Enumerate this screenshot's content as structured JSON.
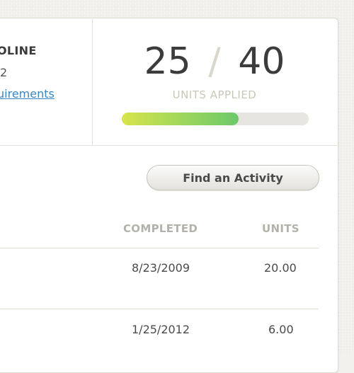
{
  "status": {
    "title": "OLINE",
    "subtitle": "2",
    "link_text": "uirements"
  },
  "units": {
    "applied": "25",
    "separator": "/",
    "required": "40",
    "label": "UNITS APPLIED",
    "progress_fraction": 0.625
  },
  "actions": {
    "find_activity_label": "Find an Activity"
  },
  "table": {
    "headers": {
      "completed": "COMPLETED",
      "units": "UNITS"
    },
    "rows": [
      {
        "completed": "8/23/2009",
        "units": "20.00"
      },
      {
        "completed": "1/25/2012",
        "units": "6.00"
      }
    ]
  },
  "colors": {
    "progress_start": "#d9e44c",
    "progress_end": "#6cc96a",
    "link": "#3a86c4"
  }
}
